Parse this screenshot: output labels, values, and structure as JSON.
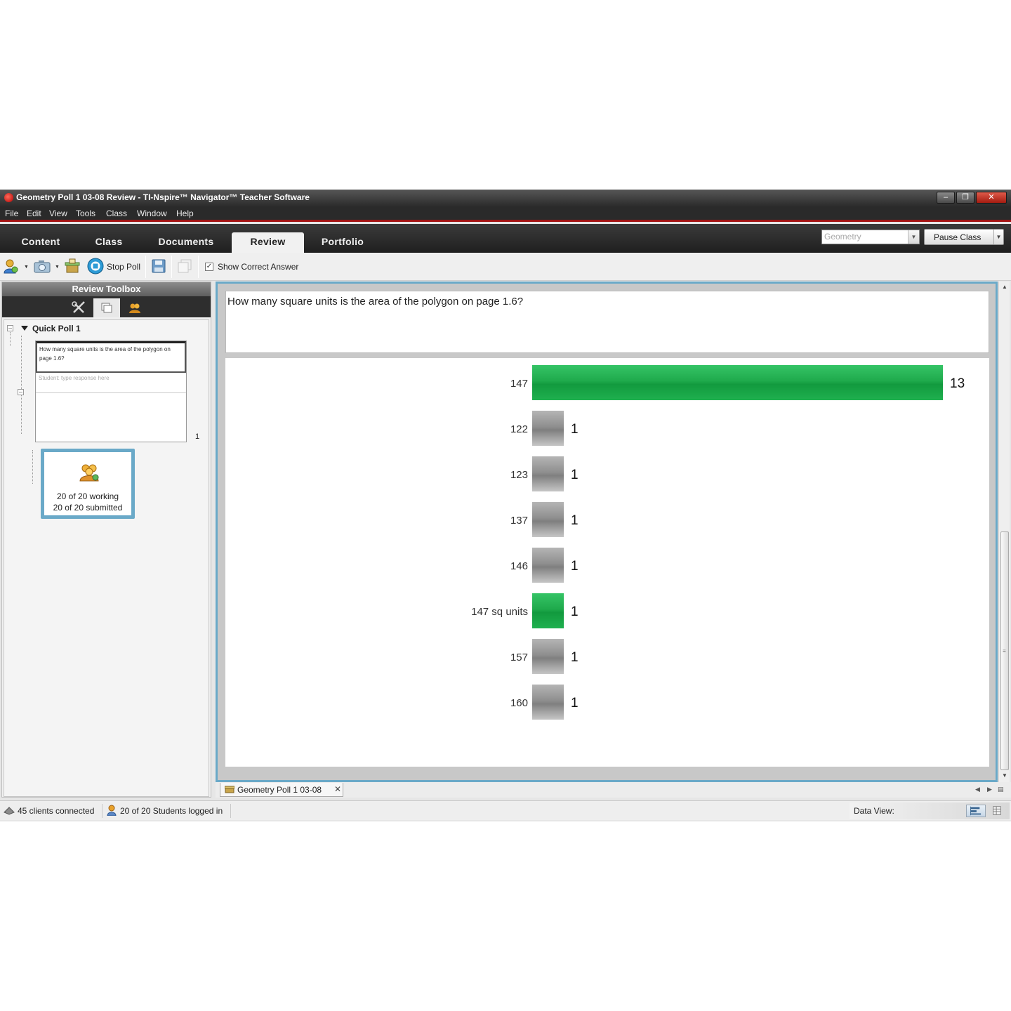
{
  "window": {
    "title": "Geometry Poll 1 03-08 Review - TI-Nspire™ Navigator™ Teacher Software"
  },
  "menu": [
    "File",
    "Edit",
    "View",
    "Tools",
    "Class",
    "Window",
    "Help"
  ],
  "tabs": [
    {
      "label": "Content",
      "active": false
    },
    {
      "label": "Class",
      "active": false
    },
    {
      "label": "Documents",
      "active": false
    },
    {
      "label": "Review",
      "active": true
    },
    {
      "label": "Portfolio",
      "active": false
    }
  ],
  "header_right": {
    "class_select": "Geometry",
    "pause_button": "Pause Class"
  },
  "toolbar": {
    "stop_poll": "Stop Poll",
    "show_correct_answer": "Show Correct Answer",
    "show_correct_checked": true
  },
  "toolbox": {
    "title": "Review Toolbox",
    "tree_root": "Quick Poll 1",
    "question_preview": "How many square units is the area of the polygon on page 1.6?",
    "response_placeholder": "Student: type response here",
    "count": "1",
    "status_working": "20 of 20 working",
    "status_submitted": "20 of 20 submitted"
  },
  "question": "How many square units is the area of the polygon on page 1.6?",
  "chart_data": {
    "type": "bar",
    "orientation": "horizontal",
    "categories": [
      "147",
      "122",
      "123",
      "137",
      "146",
      "147 sq units",
      "157",
      "160"
    ],
    "values": [
      13,
      1,
      1,
      1,
      1,
      1,
      1,
      1
    ],
    "correct": [
      true,
      false,
      false,
      false,
      false,
      true,
      false,
      false
    ],
    "colors": {
      "correct": "#1ea84a",
      "incorrect": "#8f8f8f"
    },
    "xlim": [
      0,
      13
    ]
  },
  "doc_tab": "Geometry Poll 1 03-08",
  "status_bar": {
    "clients": "45 clients connected",
    "students": "20 of 20 Students logged in",
    "data_view": "Data View:"
  }
}
